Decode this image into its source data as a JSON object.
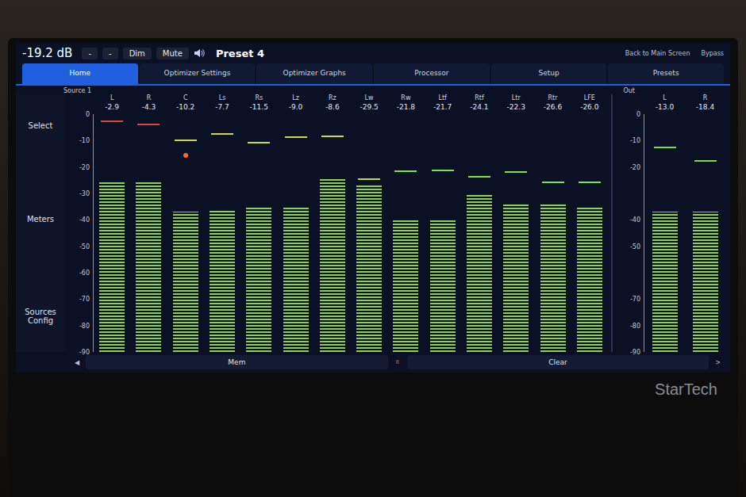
{
  "top_bar": {
    "volume": "-19.2 dB",
    "buttons": [
      "-",
      "-",
      "Dim",
      "Mute"
    ],
    "preset": "Preset 4",
    "links": [
      "Back to Main Screen",
      "Bypass"
    ]
  },
  "tabs": [
    {
      "label": "Home",
      "selected": true
    },
    {
      "label": "Optimizer Settings",
      "selected": false
    },
    {
      "label": "Optimizer Graphs",
      "selected": false
    },
    {
      "label": "Processor",
      "selected": false
    },
    {
      "label": "Setup",
      "selected": false
    },
    {
      "label": "Presets",
      "selected": false
    }
  ],
  "source": "Source 1",
  "out_label": "Out",
  "sidebar": {
    "items": [
      "Select",
      "Meters",
      "Sources Config"
    ]
  },
  "scale": [
    "0",
    "-10",
    "-20",
    "-30",
    "-40",
    "-50",
    "-60",
    "-70",
    "-80",
    "-90"
  ],
  "out_scale": [
    "0",
    "-10",
    "-20",
    "-40",
    "-50",
    "-70",
    "-80",
    "-90"
  ],
  "channels": [
    {
      "name": "L",
      "reading": "-2.9",
      "level": 0.72,
      "peak_level": 0.967,
      "peak_color": "#e0443c",
      "over": false
    },
    {
      "name": "R",
      "reading": "-4.3",
      "level": 0.72,
      "peak_level": 0.952,
      "peak_color": "#e0443c",
      "over": false
    },
    {
      "name": "C",
      "reading": "-10.2",
      "level": 0.589,
      "peak_level": 0.887,
      "peak_color": "#c8d84a",
      "over": true
    },
    {
      "name": "Ls",
      "reading": "-7.7",
      "level": 0.6,
      "peak_level": 0.914,
      "peak_color": "#c8d84a",
      "over": false
    },
    {
      "name": "Rs",
      "reading": "-11.5",
      "level": 0.611,
      "peak_level": 0.878,
      "peak_color": "#c8d84a",
      "over": false
    },
    {
      "name": "Lz",
      "reading": "-9.0",
      "level": 0.611,
      "peak_level": 0.9,
      "peak_color": "#c8d84a",
      "over": false
    },
    {
      "name": "Rz",
      "reading": "-8.6",
      "level": 0.733,
      "peak_level": 0.904,
      "peak_color": "#c8d84a",
      "over": false
    },
    {
      "name": "Lw",
      "reading": "-29.5",
      "level": 0.7,
      "peak_level": 0.722,
      "peak_color": "#b8d84a",
      "over": false
    },
    {
      "name": "Rw",
      "reading": "-21.8",
      "level": 0.556,
      "peak_level": 0.758,
      "peak_color": "#7fe04a",
      "over": false
    },
    {
      "name": "Ltf",
      "reading": "-21.7",
      "level": 0.556,
      "peak_level": 0.759,
      "peak_color": "#7fe04a",
      "over": false
    },
    {
      "name": "Rtf",
      "reading": "-24.1",
      "level": 0.667,
      "peak_level": 0.733,
      "peak_color": "#7fe04a",
      "over": false
    },
    {
      "name": "Ltr",
      "reading": "-22.3",
      "level": 0.622,
      "peak_level": 0.752,
      "peak_color": "#7fe04a",
      "over": false
    },
    {
      "name": "Rtr",
      "reading": "-26.6",
      "level": 0.622,
      "peak_level": 0.711,
      "peak_color": "#7fe04a",
      "over": false
    },
    {
      "name": "LFE",
      "reading": "-26.0",
      "level": 0.611,
      "peak_level": 0.711,
      "peak_color": "#7fe04a",
      "over": false
    }
  ],
  "outputs": [
    {
      "name": "L",
      "reading": "-13.0",
      "level": 0.589,
      "peak_level": 0.856,
      "peak_color": "#7fd84a",
      "over": false
    },
    {
      "name": "R",
      "reading": "-18.4",
      "level": 0.589,
      "peak_level": 0.8,
      "peak_color": "#7fd84a",
      "over": false
    }
  ],
  "bottom_buttons": [
    "Mem",
    "Clear"
  ],
  "pause_mark": "II",
  "scroll_left": "◀",
  "scroll_right": ">",
  "brand": "StarTech"
}
